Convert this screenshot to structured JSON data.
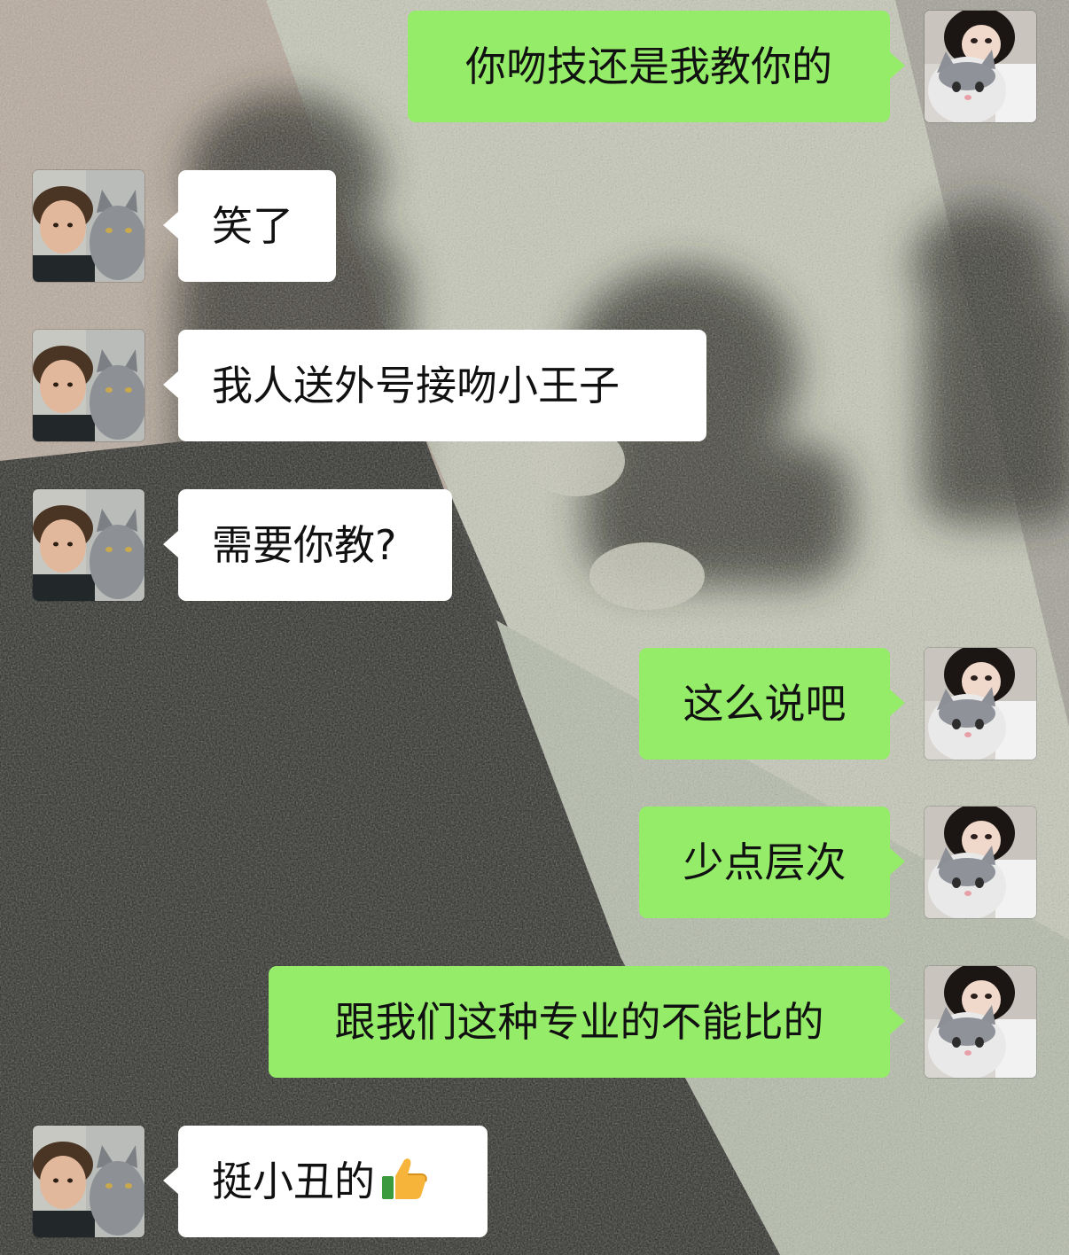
{
  "colors": {
    "self_bubble": "#95ec69",
    "friend_bubble": "#ffffff",
    "text": "#111111"
  },
  "messages": [
    {
      "sender": "self",
      "text": "你吻技还是我教你的"
    },
    {
      "sender": "friend",
      "text": "笑了"
    },
    {
      "sender": "friend",
      "text": "我人送外号接吻小王子"
    },
    {
      "sender": "friend",
      "text": "需要你教?"
    },
    {
      "sender": "self",
      "text": "这么说吧"
    },
    {
      "sender": "self",
      "text": "少点层次"
    },
    {
      "sender": "self",
      "text": "跟我们这种专业的不能比的"
    },
    {
      "sender": "friend",
      "text": "挺小丑的",
      "emoji": "thumbs-up-icon"
    }
  ],
  "avatars": {
    "self": "girl-with-white-cat-avatar",
    "friend": "boy-with-grey-cat-avatar"
  }
}
